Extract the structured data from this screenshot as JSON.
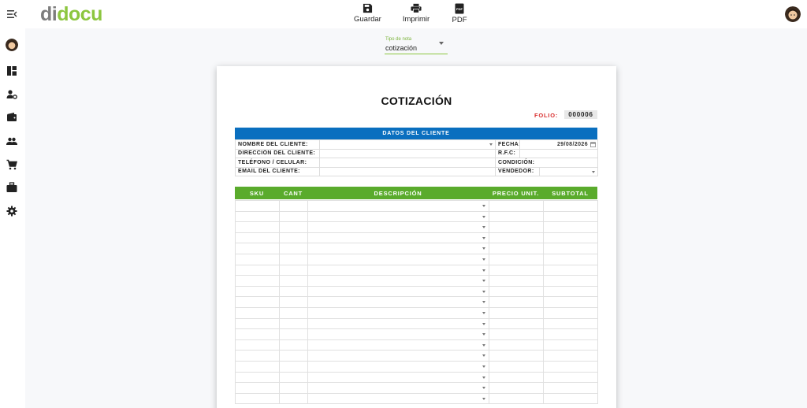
{
  "app": {
    "logo_part1": "di",
    "logo_part2": "docu"
  },
  "toolbar": {
    "save_label": "Guardar",
    "print_label": "Imprimir",
    "pdf_label": "PDF",
    "pdf_icon_text": "PDF"
  },
  "sidebar": {
    "items": [
      {
        "icon": "dashboard-icon"
      },
      {
        "icon": "user-settings-icon"
      },
      {
        "icon": "wallet-icon"
      },
      {
        "icon": "people-icon"
      },
      {
        "icon": "cart-icon"
      },
      {
        "icon": "briefcase-icon"
      },
      {
        "icon": "gear-icon"
      }
    ]
  },
  "note_type": {
    "label": "Tipo de nota",
    "value": "cotización"
  },
  "document": {
    "title": "COTIZACIÓN",
    "folio_label": "FOLIO:",
    "folio_value": "000006",
    "client_section_title": "DATOS DEL CLIENTE",
    "fields": {
      "client_name": "NOMBRE DEL CLIENTE:",
      "address": "DIRECCIÓN DEL CLIENTE:",
      "phone": "TELÉFONO / CELULAR:",
      "email": "EMAIL DEL CLIENTE:",
      "date": "FECHA:",
      "date_value": "29/08/2026",
      "rfc": "R.F.C:",
      "condition": "CONDICIÓN:",
      "seller": "VENDEDOR:"
    },
    "items_columns": {
      "sku": "SKU",
      "qty": "CANT",
      "description": "DESCRIPCIÓN",
      "unit_price": "PRECIO UNIT.",
      "subtotal": "SUBTOTAL"
    },
    "item_rows": 19
  },
  "colors": {
    "brand_green": "#8cc63f",
    "brand_gray": "#7d7d7d",
    "client_header_blue": "#0a6fbf",
    "items_header_green": "#5aab2c",
    "folio_red": "#d93030"
  }
}
